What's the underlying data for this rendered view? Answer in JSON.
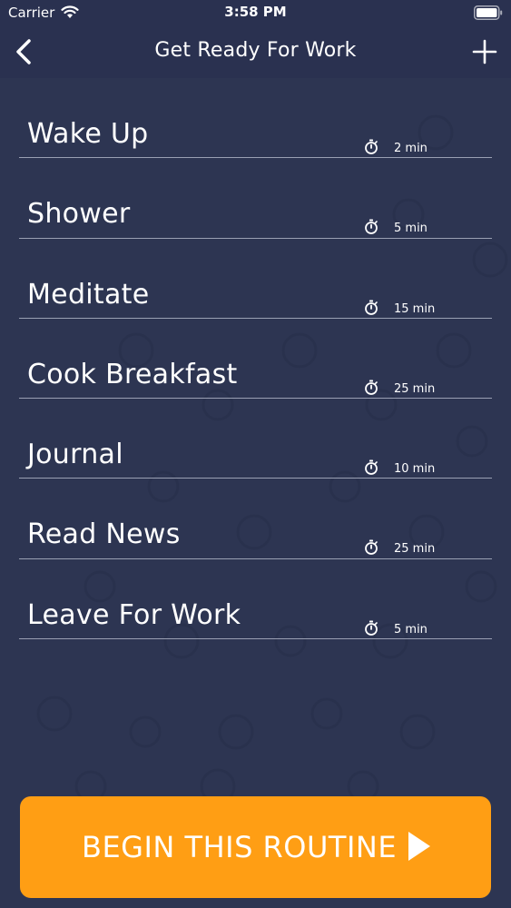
{
  "status_bar": {
    "carrier": "Carrier",
    "time": "3:58 PM",
    "icons": [
      "wifi-icon",
      "battery-icon"
    ]
  },
  "nav": {
    "title": "Get Ready For Work",
    "back_icon": "chevron-left-icon",
    "add_icon": "plus-icon"
  },
  "routine_steps": [
    {
      "name": "Wake Up",
      "duration": "2 min"
    },
    {
      "name": "Shower",
      "duration": "5 min"
    },
    {
      "name": "Meditate",
      "duration": "15 min"
    },
    {
      "name": "Cook Breakfast",
      "duration": "25 min"
    },
    {
      "name": "Journal",
      "duration": "10 min"
    },
    {
      "name": "Read News",
      "duration": "25 min"
    },
    {
      "name": "Leave For Work",
      "duration": "5 min"
    }
  ],
  "timer_icon": "stopwatch-icon",
  "begin_button": {
    "label": "BEGIN THIS ROUTINE",
    "icon": "play-icon"
  },
  "colors": {
    "background": "#2d3552",
    "nav_background": "#2a3150",
    "accent": "#ff9e14",
    "divider": "#9aa0b3",
    "text": "#ffffff"
  }
}
